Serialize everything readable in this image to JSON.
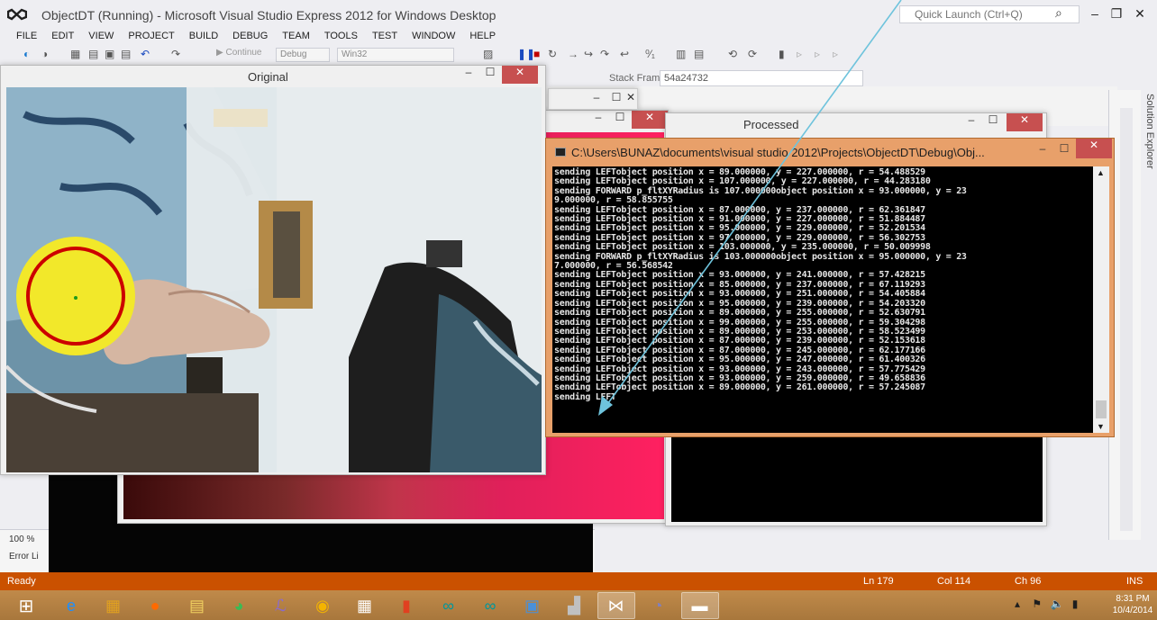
{
  "vs": {
    "title": "ObjectDT (Running) - Microsoft Visual Studio Express 2012 for Windows Desktop",
    "quick_launch_placeholder": "Quick Launch (Ctrl+Q)",
    "menu": [
      "FILE",
      "EDIT",
      "VIEW",
      "PROJECT",
      "BUILD",
      "DEBUG",
      "TEAM",
      "TOOLS",
      "TEST",
      "WINDOW",
      "HELP"
    ],
    "toolbar": {
      "continue_label": "Continue",
      "config_combo": "Debug",
      "platform_combo": "Win32",
      "stack_frame_label": "Stack Frame:",
      "stack_frame_value": "54a24732"
    },
    "solution_explorer": "Solution Explorer",
    "zoom": "100 %",
    "error_list": "Error Li",
    "status": {
      "ready": "Ready",
      "ln": "Ln 179",
      "col": "Col 114",
      "ch": "Ch 96",
      "ins": "INS"
    }
  },
  "windows": {
    "original_title": "Original",
    "processed_title": "Processed",
    "console_title": "C:\\Users\\BUNAZ\\documents\\visual studio 2012\\Projects\\ObjectDT\\Debug\\Obj..."
  },
  "console_lines": [
    "sending LEFTobject position x = 89.000000, y = 227.000000, r = 54.488529",
    "sending LEFTobject position x = 107.000000, y = 227.000000, r = 44.283180",
    "sending FORWARD p_fltXYRadius is 107.000000object position x = 93.000000, y = 23",
    "9.000000, r = 58.855755",
    "sending LEFTobject position x = 87.000000, y = 237.000000, r = 62.361847",
    "sending LEFTobject position x = 91.000000, y = 227.000000, r = 51.884487",
    "sending LEFTobject position x = 95.000000, y = 229.000000, r = 52.201534",
    "sending LEFTobject position x = 97.000000, y = 229.000000, r = 56.302753",
    "sending LEFTobject position x = 103.000000, y = 235.000000, r = 50.009998",
    "sending FORWARD p_fltXYRadius is 103.000000object position x = 95.000000, y = 23",
    "7.000000, r = 56.568542",
    "sending LEFTobject position x = 93.000000, y = 241.000000, r = 57.428215",
    "sending LEFTobject position x = 85.000000, y = 237.000000, r = 67.119293",
    "sending LEFTobject position x = 93.000000, y = 251.000000, r = 54.405884",
    "sending LEFTobject position x = 95.000000, y = 239.000000, r = 54.203320",
    "sending LEFTobject position x = 89.000000, y = 255.000000, r = 52.630791",
    "sending LEFTobject position x = 99.000000, y = 255.000000, r = 59.304298",
    "sending LEFTobject position x = 89.000000, y = 253.000000, r = 58.523499",
    "sending LEFTobject position x = 87.000000, y = 239.000000, r = 52.153618",
    "sending LEFTobject position x = 87.000000, y = 245.000000, r = 62.177166",
    "sending LEFTobject position x = 95.000000, y = 247.000000, r = 61.400326",
    "sending LEFTobject position x = 93.000000, y = 243.000000, r = 57.775429",
    "sending LEFTobject position x = 93.000000, y = 259.000000, r = 49.658836",
    "sending LEFTobject position x = 89.000000, y = 261.000000, r = 57.245087",
    "sending LEFT"
  ],
  "taskbar": {
    "apps": [
      {
        "name": "internet-explorer",
        "glyph": "e",
        "color": "#1e90ff"
      },
      {
        "name": "paint",
        "glyph": "▦",
        "color": "#e0a020"
      },
      {
        "name": "firefox",
        "glyph": "●",
        "color": "#ff6a00"
      },
      {
        "name": "file-explorer",
        "glyph": "▤",
        "color": "#f0d060"
      },
      {
        "name": "picasa",
        "glyph": "◕",
        "color": "#3cba54"
      },
      {
        "name": "visual-studio-tool",
        "glyph": "ℒ",
        "color": "#8a6ad0"
      },
      {
        "name": "chrome",
        "glyph": "◉",
        "color": "#f4b400"
      },
      {
        "name": "store",
        "glyph": "▦",
        "color": "#ffffff"
      },
      {
        "name": "office",
        "glyph": "▮",
        "color": "#e04020"
      },
      {
        "name": "arduino",
        "glyph": "∞",
        "color": "#00979d"
      },
      {
        "name": "arduino-2",
        "glyph": "∞",
        "color": "#00979d"
      },
      {
        "name": "network-tool",
        "glyph": "▣",
        "color": "#4a90d9"
      },
      {
        "name": "usb-tool",
        "glyph": "▟",
        "color": "#c0c0c0"
      },
      {
        "name": "visual-studio",
        "glyph": "⋈",
        "color": "#ffffff"
      },
      {
        "name": "media-tool",
        "glyph": "◔",
        "color": "#8080c0"
      },
      {
        "name": "console-app",
        "glyph": "▬",
        "color": "#ffffff"
      }
    ],
    "clock_time": "8:31 PM",
    "clock_date": "10/4/2014"
  },
  "colors": {
    "vs_chrome": "#eeeef2",
    "status_orange": "#ca5100",
    "console_frame": "#e8a06a",
    "arrow": "#6ec3dc",
    "tracking_circle": "#cc0000",
    "ball": "#f0e020"
  }
}
